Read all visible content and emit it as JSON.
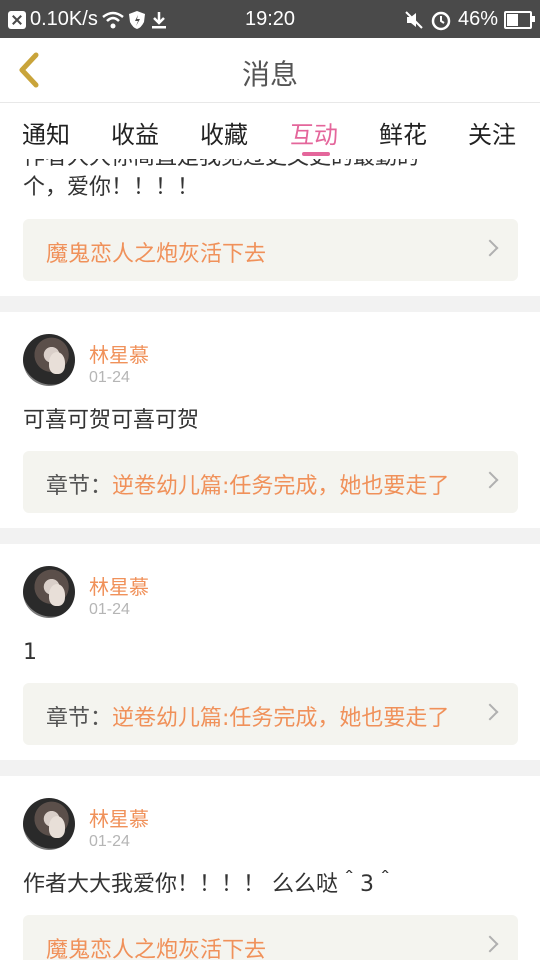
{
  "status_bar": {
    "speed": "0.10K/s",
    "time": "19:20",
    "battery": "46%"
  },
  "header": {
    "title": "消息"
  },
  "tabs": [
    {
      "label": "通知"
    },
    {
      "label": "收益"
    },
    {
      "label": "收藏"
    },
    {
      "label": "互动"
    },
    {
      "label": "鲜花"
    },
    {
      "label": "关注"
    }
  ],
  "active_tab": "互动",
  "partial_card": {
    "message_line1": "作者大大你简直是我见过更文更的最勤的",
    "message_line2": "个，爱你！！！！",
    "ref_link": "魔鬼恋人之炮灰活下去"
  },
  "cards": [
    {
      "name": "林星慕",
      "date": "01-24",
      "message": "可喜可贺可喜可贺",
      "ref_prefix": "章节：",
      "ref_link": "逆卷幼儿篇:任务完成，她也要走了"
    },
    {
      "name": "林星慕",
      "date": "01-24",
      "message": "1",
      "ref_prefix": "章节：",
      "ref_link": "逆卷幼儿篇:任务完成，她也要走了"
    },
    {
      "name": "林星慕",
      "date": "01-24",
      "message": "作者大大我爱你！！！！ 么么哒＾3＾",
      "ref_prefix": "",
      "ref_link": "魔鬼恋人之炮灰活下去"
    }
  ]
}
